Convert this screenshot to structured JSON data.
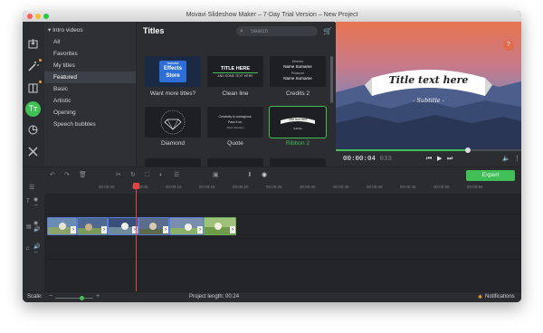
{
  "window": {
    "title": "Movavi Slideshow Maker – 7-Day Trial Version – New Project"
  },
  "sidebar_tools": [
    "import-icon",
    "magic-wand-icon",
    "transitions-icon",
    "titles-icon",
    "stickers-icon",
    "tools-icon"
  ],
  "categories": [
    {
      "label": "▾ Intro videos"
    },
    {
      "label": "All"
    },
    {
      "label": "Favorites"
    },
    {
      "label": "My titles"
    },
    {
      "label": "Featured"
    },
    {
      "label": "Basic"
    },
    {
      "label": "Artistic"
    },
    {
      "label": "Opening"
    },
    {
      "label": "Speech bubbles"
    }
  ],
  "gallery": {
    "title": "Titles",
    "search_placeholder": "Search",
    "items": [
      {
        "label": "Want more titles?",
        "thumb_top": "movavi",
        "thumb_main": "Effects",
        "thumb_sub": "Store"
      },
      {
        "label": "Clean line",
        "thumb_main": "TITLE HERE",
        "thumb_sub": "AND SOME TEXT HERE"
      },
      {
        "label": "Credits 2",
        "thumb_top": "Director",
        "thumb_main": "Name Surname",
        "thumb_sub": "Producer",
        "thumb_extra": "Name Surname"
      },
      {
        "label": "Diamond"
      },
      {
        "label": "Quote",
        "thumb_main": "Creativity is contagious.",
        "thumb_sub": "Pass it on.",
        "thumb_extra": "Albert Einstein"
      },
      {
        "label": "Ribbon 2",
        "thumb_main": "Title text here",
        "thumb_sub": "Subtitle"
      }
    ]
  },
  "preview": {
    "title": "Title text here",
    "subtitle": "- Subtitle -",
    "help": "?"
  },
  "player": {
    "time_main": "00:00:04",
    "time_frac": "033",
    "progress": 0.71
  },
  "editor": {
    "export_label": "Export"
  },
  "ruler_marks": [
    "00:00:00",
    "00:00:05",
    "00:00:10",
    "00:00:15",
    "00:00:20",
    "00:00:25",
    "00:00:30",
    "00:00:35",
    "00:00:40",
    "00:00:45",
    "00:00:50",
    "00:00:55"
  ],
  "status": {
    "scale_label": "Scale:",
    "project_length": "Project length:  00:24",
    "notifications": "Notifications",
    "zoom_level": 0.7
  },
  "colors": {
    "accent": "#3fbf55",
    "playhead": "#e24444",
    "clip_border": "#5a7cd9"
  }
}
